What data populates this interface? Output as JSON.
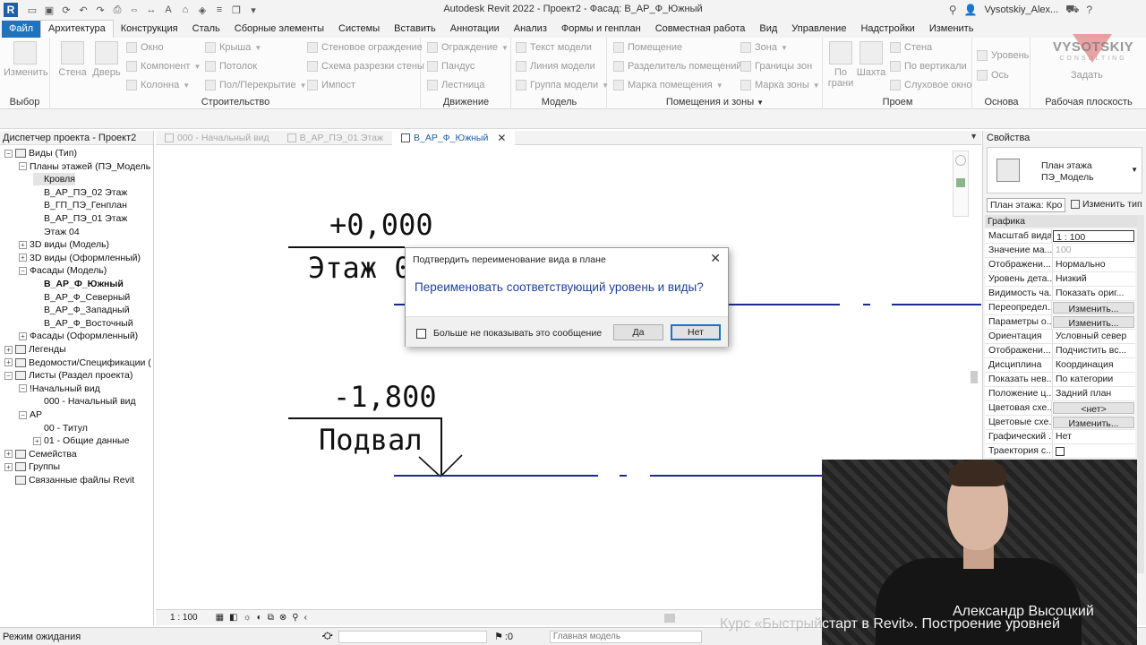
{
  "app": {
    "title": "Autodesk Revit 2022 - Проект2 - Фасад: В_АР_Ф_Южный",
    "user": "Vysotskiy_Alex...",
    "logo_letter": "R"
  },
  "ribbon_tabs": [
    "Файл",
    "Архитектура",
    "Конструкция",
    "Сталь",
    "Сборные элементы",
    "Системы",
    "Вставить",
    "Аннотации",
    "Анализ",
    "Формы и генплан",
    "Совместная работа",
    "Вид",
    "Управление",
    "Надстройки",
    "Изменить"
  ],
  "ribbon": {
    "select": {
      "modify": "Изменить",
      "label": "Выбор"
    },
    "build": {
      "wall": "Стена",
      "door": "Дверь",
      "window": "Окно",
      "component": "Компонент",
      "column": "Колонна",
      "roof": "Крыша",
      "ceiling": "Потолок",
      "floor": "Пол/Перекрытие",
      "curtain_wall": "Стеновое ограждение",
      "curtain_grid": "Схема разрезки стены",
      "mullion": "Импост",
      "label": "Строительство"
    },
    "circulation": {
      "railing": "Ограждение",
      "ramp": "Пандус",
      "stair": "Лестница",
      "label": "Движение"
    },
    "model": {
      "text": "Текст модели",
      "line": "Линия модели",
      "group": "Группа модели",
      "label": "Модель"
    },
    "room": {
      "room": "Помещение",
      "separator": "Разделитель помещений",
      "tag": "Марка помещения",
      "area": "Зона",
      "area_bound": "Границы зон",
      "area_tag": "Марка зоны",
      "label": "Помещения и зоны"
    },
    "opening": {
      "by_face": "По грани",
      "shaft": "Шахта",
      "wall": "Стена",
      "vertical": "По вертикали",
      "dormer": "Слуховое окно",
      "label": "Проем"
    },
    "datum": {
      "level": "Уровень",
      "grid": "Ось",
      "label": "Основа"
    },
    "work_plane": {
      "set": "Задать",
      "label": "Рабочая плоскость"
    }
  },
  "brand": {
    "name": "VYSOTSKIY",
    "sub": "CONSULTING"
  },
  "browser": {
    "title": "Диспетчер проекта - Проект2",
    "items": [
      {
        "label": "Виды (Тип)",
        "level": 0,
        "toggle": "−",
        "icon": true
      },
      {
        "label": "Планы этажей (ПЭ_Модель",
        "level": 1,
        "toggle": "−"
      },
      {
        "label": "Кровля",
        "level": 2,
        "selected": true
      },
      {
        "label": "В_АР_ПЭ_02 Этаж",
        "level": 2
      },
      {
        "label": "В_ГП_ПЭ_Генплан",
        "level": 2
      },
      {
        "label": "В_АР_ПЭ_01 Этаж",
        "level": 2
      },
      {
        "label": "Этаж 04",
        "level": 2
      },
      {
        "label": "3D виды (Модель)",
        "level": 1,
        "toggle": "+"
      },
      {
        "label": "3D виды (Оформленный)",
        "level": 1,
        "toggle": "+"
      },
      {
        "label": "Фасады (Модель)",
        "level": 1,
        "toggle": "−"
      },
      {
        "label": "В_АР_Ф_Южный",
        "level": 2,
        "bold": true
      },
      {
        "label": "В_АР_Ф_Северный",
        "level": 2
      },
      {
        "label": "В_АР_Ф_Западный",
        "level": 2
      },
      {
        "label": "В_АР_Ф_Восточный",
        "level": 2
      },
      {
        "label": "Фасады (Оформленный)",
        "level": 1,
        "toggle": "+"
      },
      {
        "label": "Легенды",
        "level": 0,
        "toggle": "+",
        "icon": true
      },
      {
        "label": "Ведомости/Спецификации (",
        "level": 0,
        "toggle": "+",
        "icon": true
      },
      {
        "label": "Листы (Раздел проекта)",
        "level": 0,
        "toggle": "−",
        "icon": true
      },
      {
        "label": "!Начальный вид",
        "level": 1,
        "toggle": "−"
      },
      {
        "label": "000 - Начальный вид",
        "level": 2
      },
      {
        "label": "АР",
        "level": 1,
        "toggle": "−"
      },
      {
        "label": "00 - Титул",
        "level": 2
      },
      {
        "label": "01 - Общие данные",
        "level": 2,
        "toggle": "+"
      },
      {
        "label": "Семейства",
        "level": 0,
        "toggle": "+",
        "icon": true
      },
      {
        "label": "Группы",
        "level": 0,
        "toggle": "+",
        "icon": true
      },
      {
        "label": "Связанные файлы Revit",
        "level": 0,
        "icon": true
      }
    ]
  },
  "view_tabs": [
    {
      "label": "000 - Начальный вид",
      "active": false
    },
    {
      "label": "В_АР_ПЭ_01 Этаж",
      "active": false
    },
    {
      "label": "В_АР_Ф_Южный",
      "active": true
    }
  ],
  "canvas": {
    "level1": {
      "elev": "+0,000",
      "name": "Этаж 01"
    },
    "level2": {
      "elev": "-1,800",
      "name": "Подвал"
    }
  },
  "dialog": {
    "title": "Подтвердить переименование вида в плане",
    "message": "Переименовать соответствующий уровень и виды?",
    "dont_show": "Больше не показывать это сообщение",
    "yes": "Да",
    "no": "Нет"
  },
  "properties": {
    "title": "Свойства",
    "type_name_line1": "План этажа",
    "type_name_line2": "ПЭ_Модель",
    "instance_select": "План этажа: Кро",
    "edit_type": "Изменить тип",
    "group": "Графика",
    "rows": [
      {
        "name": "Масштаб вида",
        "value": "1 : 100",
        "kind": "input"
      },
      {
        "name": "Значение ма...",
        "value": "100",
        "kind": "dim"
      },
      {
        "name": "Отображени...",
        "value": "Нормально"
      },
      {
        "name": "Уровень дета...",
        "value": "Низкий"
      },
      {
        "name": "Видимость ча...",
        "value": "Показать ориг..."
      },
      {
        "name": "Переопредел...",
        "value": "Изменить...",
        "kind": "btn"
      },
      {
        "name": "Параметры о...",
        "value": "Изменить...",
        "kind": "btn"
      },
      {
        "name": "Ориентация",
        "value": "Условный север"
      },
      {
        "name": "Отображени...",
        "value": "Подчистить вс..."
      },
      {
        "name": "Дисциплина",
        "value": "Координация"
      },
      {
        "name": "Показать нев...",
        "value": "По категории"
      },
      {
        "name": "Положение ц...",
        "value": "Задний план"
      },
      {
        "name": "Цветовая схе...",
        "value": "<нет>",
        "kind": "btn"
      },
      {
        "name": "Цветовые схе...",
        "value": "Изменить...",
        "kind": "btn"
      },
      {
        "name": "Графический ...",
        "value": "Нет"
      },
      {
        "name": "Траектория с...",
        "value": "",
        "kind": "check"
      }
    ]
  },
  "view_control": {
    "scale": "1 : 100"
  },
  "status": {
    "text": "Режим ожидания",
    "count": ":0",
    "model": "Главная модель"
  },
  "overlay": {
    "name": "Александр Высоцкий",
    "course_prefix": "Курс «Быстрый",
    "course_suffix": "старт в Revit». Построение уровней"
  }
}
